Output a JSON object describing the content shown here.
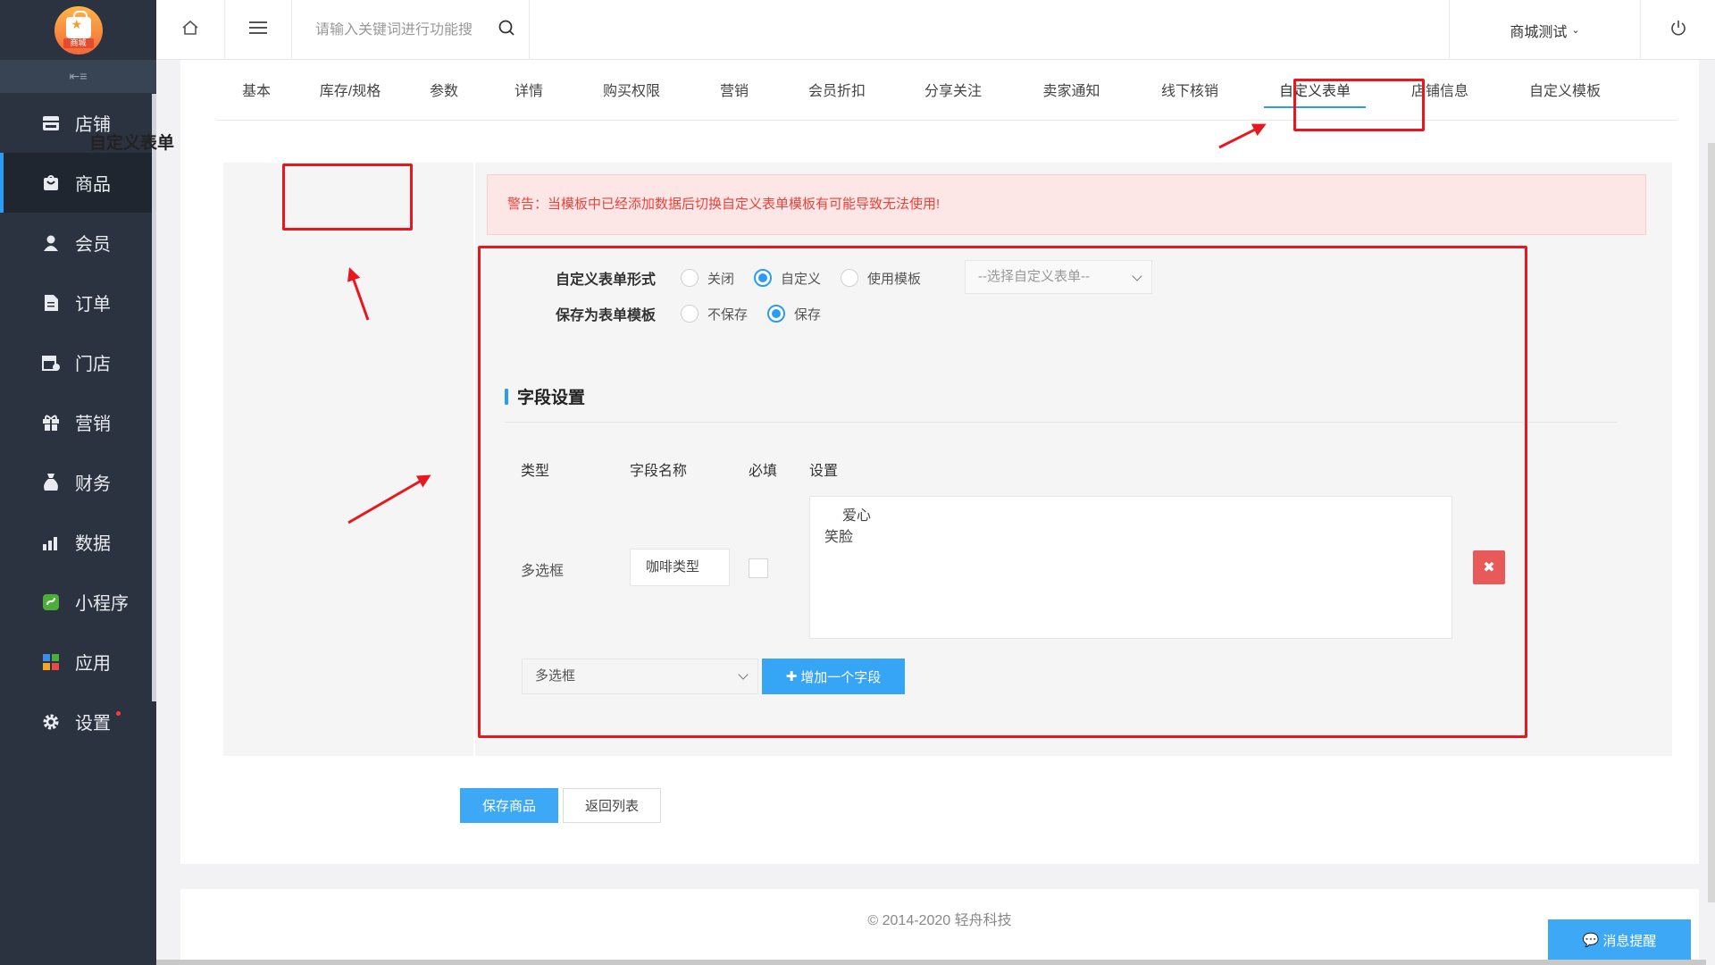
{
  "logo": {
    "text": "商城"
  },
  "sidebar": {
    "collapse_icon": "collapse-icon",
    "items": [
      {
        "label": "店铺",
        "icon": "store-icon"
      },
      {
        "label": "商品",
        "icon": "goods-icon",
        "active": true
      },
      {
        "label": "会员",
        "icon": "user-icon"
      },
      {
        "label": "订单",
        "icon": "order-icon"
      },
      {
        "label": "门店",
        "icon": "shop-icon"
      },
      {
        "label": "营销",
        "icon": "gift-icon"
      },
      {
        "label": "财务",
        "icon": "money-bag-icon"
      },
      {
        "label": "数据",
        "icon": "bar-chart-icon"
      },
      {
        "label": "小程序",
        "icon": "miniprogram-icon"
      },
      {
        "label": "应用",
        "icon": "apps-icon"
      },
      {
        "label": "设置",
        "icon": "gear-icon"
      }
    ]
  },
  "topbar": {
    "search_placeholder": "请输入关键词进行功能搜",
    "user_label": "商城测试",
    "colors": {
      "accent": "#2b9cf2"
    }
  },
  "tabs": [
    "基本",
    "库存/规格",
    "参数",
    "详情",
    "购买权限",
    "营销",
    "会员折扣",
    "分享关注",
    "卖家通知",
    "线下核销",
    "自定义表单",
    "店铺信息",
    "自定义模板"
  ],
  "active_tab": "自定义表单",
  "form": {
    "panel_title": "自定义表单",
    "warning": "警告：当模板中已经添加数据后切换自定义表单模板有可能导致无法使用!",
    "form_mode": {
      "label": "自定义表单形式",
      "options": [
        "关闭",
        "自定义",
        "使用模板"
      ],
      "selected": "自定义",
      "template_select_placeholder": "--选择自定义表单--"
    },
    "save_template": {
      "label": "保存为表单模板",
      "options": [
        "不保存",
        "保存"
      ],
      "selected": "保存"
    },
    "section_title": "字段设置",
    "columns": [
      "类型",
      "字段名称",
      "必填",
      "设置"
    ],
    "rows": [
      {
        "type": "多选框",
        "field_name": "咖啡类型",
        "required": false,
        "settings_lines": [
          "爱心",
          "笑脸"
        ]
      }
    ],
    "new_field_type": "多选框",
    "add_field_label": "增加一个字段"
  },
  "actions": {
    "save": "保存商品",
    "back": "返回列表"
  },
  "footer": {
    "copyright": "© 2014-2020 轻舟科技"
  },
  "notice_button": "消息提醒"
}
